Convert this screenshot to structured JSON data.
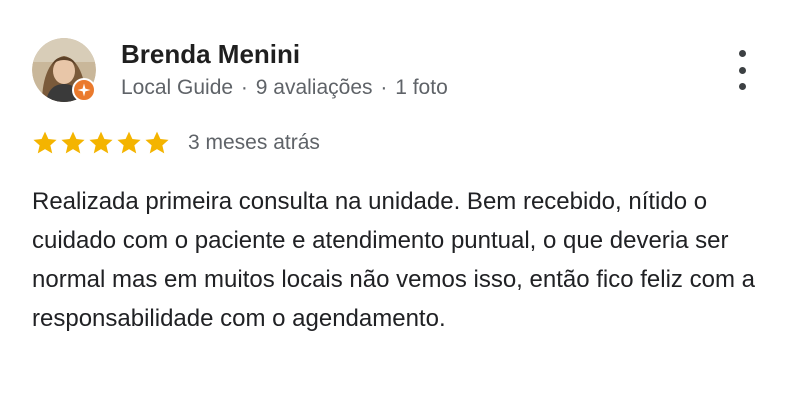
{
  "review": {
    "author": {
      "name": "Brenda Menini",
      "level": "Local Guide",
      "reviews_count": "9 avaliações",
      "photos_count": "1 foto",
      "separator": "·"
    },
    "rating": 5,
    "max_rating": 5,
    "date": "3 meses atrás",
    "text": "Realizada primeira consulta na unidade. Bem recebido, nítido o cuidado com o paciente e atendimento puntual, o que deveria ser normal mas em muitos locais não vemos isso, então fico feliz com a responsabilidade com o agendamento."
  },
  "icons": {
    "avatar": "user-avatar-photo",
    "badge": "local-guide-badge-icon",
    "menu": "more-vertical-icon",
    "star": "star-icon"
  },
  "colors": {
    "star": "#F4B400",
    "badge": "#EA7A2D",
    "name": "#1F1F1F",
    "meta": "#5F6368",
    "text": "#202124"
  }
}
